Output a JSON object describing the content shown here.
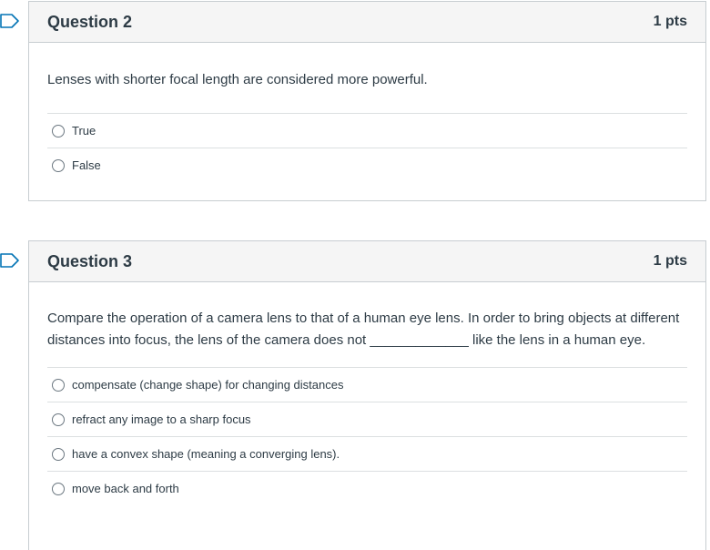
{
  "colors": {
    "flag_blue": "#0374b5",
    "header_bg": "#f5f5f5",
    "border": "#c7cdd1",
    "text": "#2d3b45"
  },
  "questions": [
    {
      "title": "Question 2",
      "points": "1 pts",
      "text": "Lenses with shorter focal length are considered more powerful.",
      "answers": [
        "True",
        "False"
      ],
      "flag_icon": "bookmark-flag-icon"
    },
    {
      "title": "Question 3",
      "points": "1 pts",
      "text": "Compare the operation of a camera lens to that of a human eye lens. In order to bring objects at different distances into focus, the lens of the camera does not _____________ like the lens in a human eye.",
      "answers": [
        "compensate (change shape) for changing distances",
        "refract any image to a sharp focus",
        "have a convex shape (meaning a converging lens).",
        "move back and forth"
      ],
      "flag_icon": "bookmark-flag-icon"
    }
  ]
}
